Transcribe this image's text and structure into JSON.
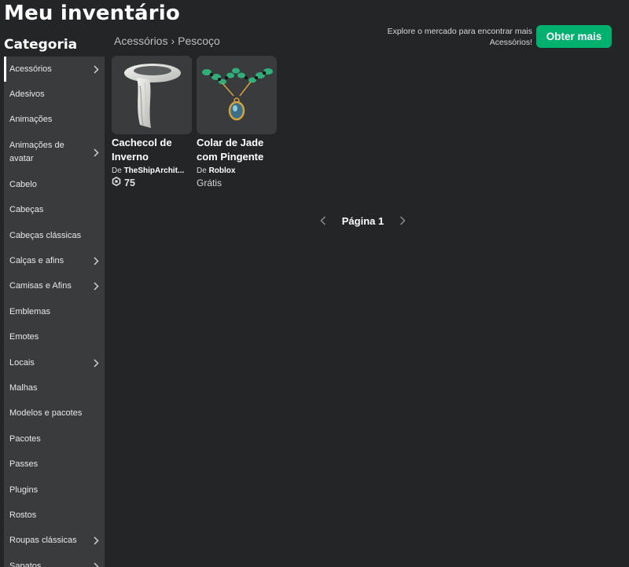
{
  "page": {
    "title": "Meu inventário"
  },
  "sidebar": {
    "heading": "Categoria",
    "items": [
      {
        "label": "Acessórios",
        "active": true,
        "chevron": true
      },
      {
        "label": "Adesivos"
      },
      {
        "label": "Animações"
      },
      {
        "label": "Animações de avatar",
        "chevron": true,
        "tall": true
      },
      {
        "label": "Cabelo"
      },
      {
        "label": "Cabeças"
      },
      {
        "label": "Cabeças clássicas"
      },
      {
        "label": "Calças e afins",
        "chevron": true
      },
      {
        "label": "Camisas e Afins",
        "chevron": true
      },
      {
        "label": "Emblemas"
      },
      {
        "label": "Emotes"
      },
      {
        "label": "Locais",
        "chevron": true
      },
      {
        "label": "Malhas"
      },
      {
        "label": "Modelos e pacotes"
      },
      {
        "label": "Pacotes"
      },
      {
        "label": "Passes"
      },
      {
        "label": "Plugins"
      },
      {
        "label": "Rostos"
      },
      {
        "label": "Roupas clássicas",
        "chevron": true
      },
      {
        "label": "Sapatos",
        "chevron": true
      }
    ]
  },
  "breadcrumb": {
    "parent": "Acessórios",
    "separator": "›",
    "current": "Pescoço"
  },
  "promo": {
    "text": "Explore o mercado para encontrar mais Acessórios!",
    "button": "Obter mais",
    "button_color": "#00b06f"
  },
  "items": [
    {
      "name": "Cachecol de Inverno",
      "creator_prefix": "De",
      "creator": "TheShipArchit...",
      "price": "75",
      "price_icon": "robux-icon"
    },
    {
      "name": "Colar de Jade com Pingente",
      "creator_prefix": "De",
      "creator": "Roblox",
      "price": "Grátis"
    }
  ],
  "pagination": {
    "label": "Página 1",
    "prev_icon": "chevron-left-icon",
    "next_icon": "chevron-right-icon"
  },
  "colors": {
    "background": "#232527",
    "panel": "#393b3d",
    "accent": "#00b06f"
  }
}
